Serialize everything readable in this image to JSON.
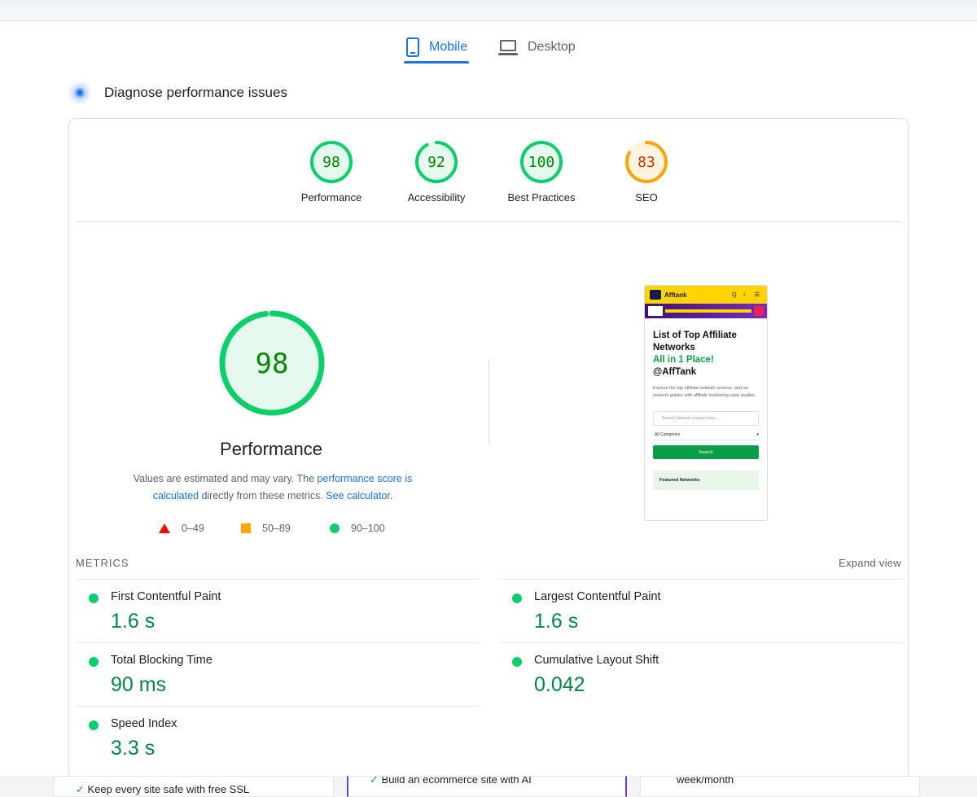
{
  "tabs": [
    {
      "label": "Mobile",
      "icon": "mobile-phone-icon",
      "active": true
    },
    {
      "label": "Desktop",
      "icon": "laptop-icon",
      "active": false
    }
  ],
  "section_title": "Diagnose performance issues",
  "scores": [
    {
      "label": "Performance",
      "value": "98",
      "score": 98,
      "color": "#0cce6b",
      "text_color": "#008800",
      "fill": "#e6f9ee"
    },
    {
      "label": "Accessibility",
      "value": "92",
      "score": 92,
      "color": "#0cce6b",
      "text_color": "#008800",
      "fill": "#e6f9ee"
    },
    {
      "label": "Best Practices",
      "value": "100",
      "score": 100,
      "color": "#0cce6b",
      "text_color": "#008800",
      "fill": "#e6f9ee"
    },
    {
      "label": "SEO",
      "value": "83",
      "score": 83,
      "color": "#ffa400",
      "text_color": "#c33300",
      "fill": "#fff4e0"
    }
  ],
  "performance": {
    "score": "98",
    "title": "Performance",
    "note_prefix": "Values are estimated and may vary. The ",
    "note_link1": "performance score is calculated",
    "note_middle": " directly from these metrics. ",
    "note_link2": "See calculator",
    "note_suffix": "."
  },
  "legend": [
    {
      "range": "0–49",
      "shape": "triangle",
      "color": "#eb0f00"
    },
    {
      "range": "50–89",
      "shape": "square",
      "color": "#ffa400"
    },
    {
      "range": "90–100",
      "shape": "circle",
      "color": "#0cce6b"
    }
  ],
  "site_preview": {
    "brand": "Afftank",
    "header_icons": "Q ☾ ☰",
    "heading_line1": "List of Top Affiliate",
    "heading_line2": "Networks",
    "heading_line3": "All in 1 Place!",
    "heading_line4": "@AffTank",
    "description": "Explore the top affiliate network reviews, and ad network guides with affiliate marketing case studies.",
    "search_placeholder": "Search Network reviews here...",
    "category_select": "All Categories",
    "search_button": "Search",
    "featured": "Featured Networks"
  },
  "metrics": {
    "heading": "METRICS",
    "expand": "Expand view",
    "items": [
      {
        "label": "First Contentful Paint",
        "value": "1.6 s"
      },
      {
        "label": "Largest Contentful Paint",
        "value": "1.6 s"
      },
      {
        "label": "Total Blocking Time",
        "value": "90 ms"
      },
      {
        "label": "Cumulative Layout Shift",
        "value": "0.042"
      },
      {
        "label": "Speed Index",
        "value": "3.3 s"
      }
    ]
  },
  "background_cards": [
    {
      "text": "Keep every site safe with free SSL"
    },
    {
      "text": "Build an ecommerce site with AI"
    },
    {
      "text": "week/month"
    }
  ]
}
